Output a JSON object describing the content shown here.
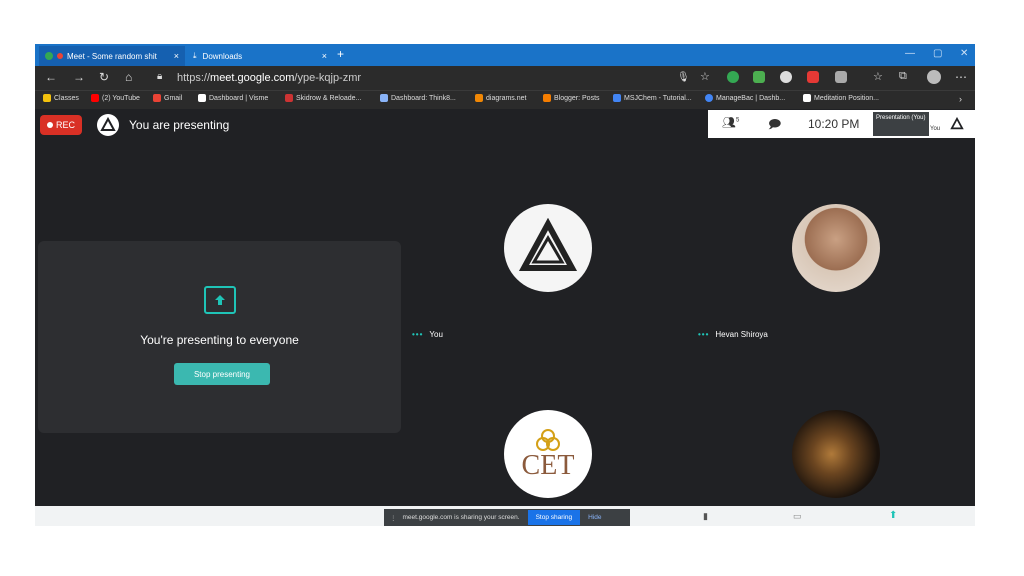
{
  "browser": {
    "tabs": [
      {
        "label": "Meet - Some random shit",
        "close": "×"
      },
      {
        "label": "Downloads",
        "close": "×"
      }
    ],
    "new_tab": "+",
    "url_scheme": "https://",
    "url_host": "meet.google.com",
    "url_path": "/ype-kqjp-zmr",
    "bookmarks": [
      {
        "label": "Classes",
        "color": "#f4c20d"
      },
      {
        "label": "(2) YouTube",
        "color": "#ff0000"
      },
      {
        "label": "Gmail",
        "color": "#ea4335"
      },
      {
        "label": "Dashboard | Visme",
        "color": "#ffffff"
      },
      {
        "label": "Skidrow & Reloade...",
        "color": "#cc3333"
      },
      {
        "label": "Dashboard: Think8...",
        "color": "#8ab4f8"
      },
      {
        "label": "diagrams.net",
        "color": "#f08705"
      },
      {
        "label": "Blogger: Posts",
        "color": "#f57d00"
      },
      {
        "label": "MSJChem - Tutorial...",
        "color": "#4285f4"
      },
      {
        "label": "ManageBac | Dashb...",
        "color": "#4285f4"
      },
      {
        "label": "Meditation Position...",
        "color": "#ffffff"
      }
    ]
  },
  "meet": {
    "rec_label": "REC",
    "presenting_title": "You are presenting",
    "participant_count": "5",
    "time": "10:20 PM",
    "presentation_tile_label": "Presentation (You)",
    "self_mini_label": "You",
    "presenting_card_text": "You're presenting to everyone",
    "stop_presenting_label": "Stop presenting",
    "participants": [
      {
        "name": "You"
      },
      {
        "name": "Hevan Shiroya"
      }
    ],
    "cet_logo_text": "CET",
    "share_notice": "meet.google.com is sharing your screen.",
    "stop_sharing_label": "Stop sharing",
    "hide_label": "Hide"
  },
  "colors": {
    "accent_teal": "#1fc4b7",
    "rec_red": "#d93025",
    "tab_blue": "#1a73c8"
  }
}
